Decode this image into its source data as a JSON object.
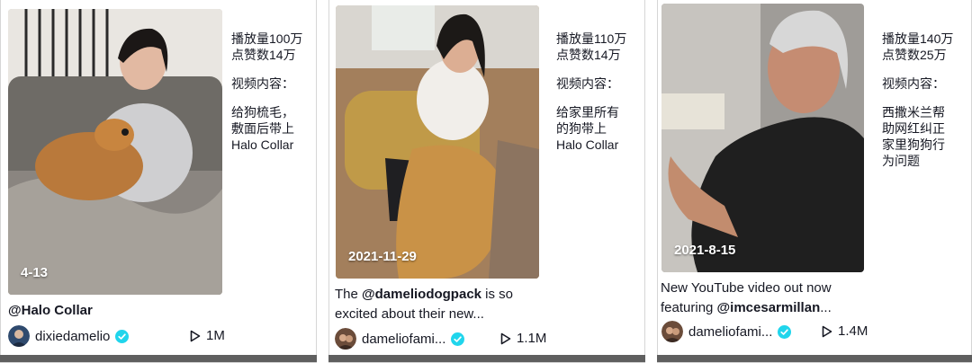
{
  "cards": [
    {
      "date": "4-13",
      "views": "播放量100万",
      "likes": "点赞数14万",
      "content_label": "视频内容：",
      "content": "给狗梳毛，\n敷面后带上\nHalo Collar",
      "caption": "@Halo Collar",
      "author": "dixiedamelio",
      "play_count": "1M"
    },
    {
      "date": "2021-11-29",
      "views": "播放量110万",
      "likes": "点赞数14万",
      "content_label": "视频内容：",
      "content": "给家里所有\n的狗带上\nHalo Collar",
      "caption_pre": "The ",
      "caption_mention": "@dameliodogpack",
      "caption_post": " is so excited about their new...",
      "author": "dameliofami...",
      "play_count": "1.1M"
    },
    {
      "date": "2021-8-15",
      "views": "播放量140万",
      "likes": "点赞数25万",
      "content_label": "视频内容：",
      "content": "西撒米兰帮\n助网红纠正\n家里狗狗行\n为问题",
      "caption_pre": "New YouTube video out now featuring ",
      "caption_mention": "@imcesarmillan",
      "caption_post": "...",
      "author": "dameliofami...",
      "play_count": "1.4M"
    }
  ],
  "colors": {
    "verified": "#20d5ec",
    "text": "#161823",
    "bottom_bar": "#5f5f5f"
  }
}
